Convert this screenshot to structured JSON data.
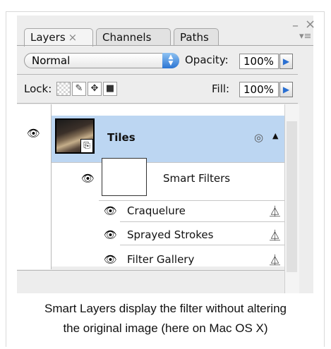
{
  "panel": {
    "tabs": [
      {
        "label": "Layers",
        "close": "×",
        "active": true
      },
      {
        "label": "Channels",
        "active": false
      },
      {
        "label": "Paths",
        "active": false
      }
    ],
    "window_controls": {
      "minimize": "–",
      "close": "×",
      "menu": "▾≡"
    },
    "blend_mode": "Normal",
    "opacity_label": "Opacity:",
    "opacity_value": "100%",
    "lock_label": "Lock:",
    "fill_label": "Fill:",
    "fill_value": "100%",
    "lock_icons": [
      "lock-transparent-icon",
      "lock-paint-icon",
      "lock-move-icon",
      "lock-all-icon"
    ]
  },
  "layers": {
    "main": {
      "name": "Tiles",
      "eye": "visibility-eye-icon"
    },
    "smart_filters_label": "Smart Filters",
    "filters": [
      {
        "name": "Craquelure"
      },
      {
        "name": "Sprayed Strokes"
      },
      {
        "name": "Filter Gallery"
      }
    ]
  },
  "caption": {
    "line1": "Smart Layers display the filter without altering",
    "line2": "the original  image (here on Mac OS X)"
  },
  "colors": {
    "selected_row": "#bcd6f2",
    "accent_blue": "#2c75d3"
  }
}
